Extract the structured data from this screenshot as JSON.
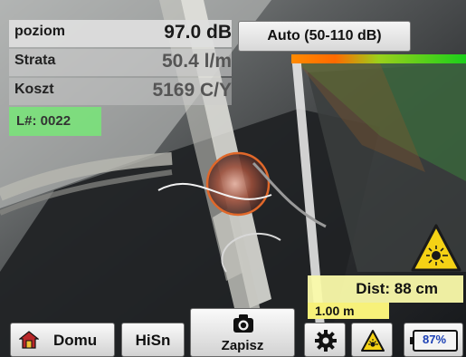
{
  "readout": {
    "level_label": "poziom",
    "level_value": "97.0 dB",
    "loss_label": "Strata",
    "loss_value": "50.4 l/m",
    "cost_label": "Koszt",
    "cost_value": "5169 C/Y"
  },
  "leak_number": "L#: 0022",
  "range_button": "Auto (50-110 dB)",
  "distance": "Dist: 88 cm",
  "scale": "1.00 m",
  "toolbar": {
    "home_label": "Domu",
    "hisn_label": "HiSn",
    "save_label": "Zapisz",
    "battery_label": "87%"
  },
  "colors": {
    "level_bar_start": "#ff8a00",
    "level_bar_end": "#1bd01b",
    "leak_marker": "#e0682a",
    "warning_yellow": "#f5d215"
  },
  "icons": {
    "home": "home-icon",
    "camera": "camera-icon",
    "settings": "gear-icon",
    "laser": "laser-warning-icon",
    "battery": "battery-icon"
  }
}
